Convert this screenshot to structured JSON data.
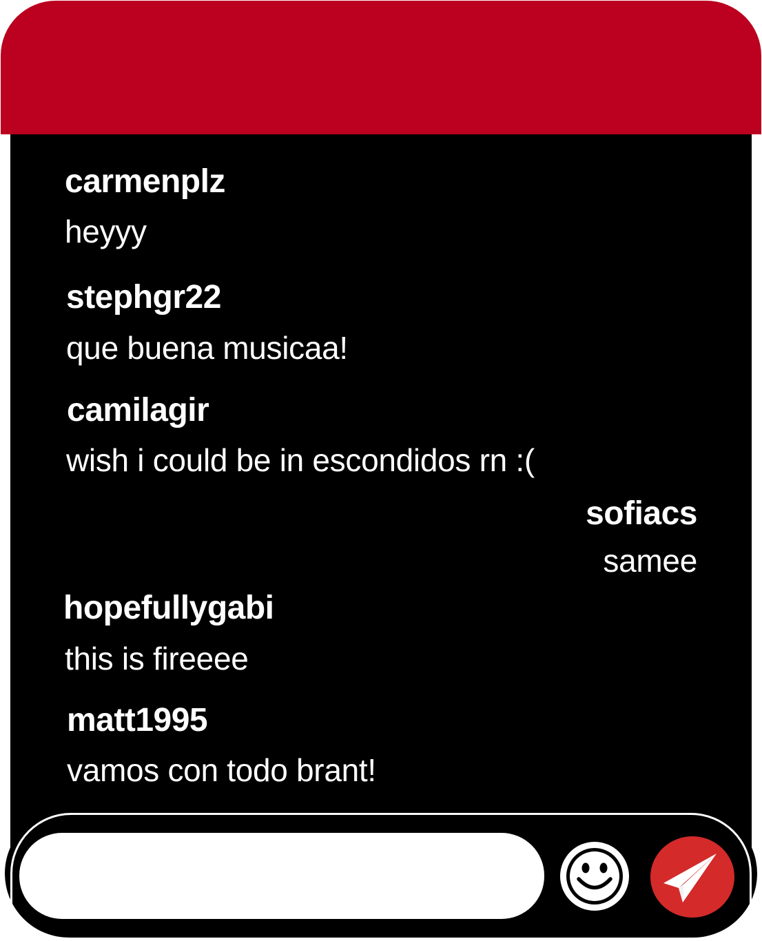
{
  "colors": {
    "header": "#bb0020",
    "background": "#000000",
    "text": "#ffffff",
    "send_button": "#d42a2a"
  },
  "messages": [
    {
      "username": "carmenplz",
      "text": "heyyy",
      "align": "left"
    },
    {
      "username": "stephgr22",
      "text": "que buena musicaa!",
      "align": "left"
    },
    {
      "username": "camilagir",
      "text": "wish i could be in escondidos rn :(",
      "align": "left"
    },
    {
      "username": "sofiacs",
      "text": "samee",
      "align": "right"
    },
    {
      "username": "hopefullygabi",
      "text": "this is fireeee",
      "align": "left"
    },
    {
      "username": "matt1995",
      "text": "vamos con todo brant!",
      "align": "left"
    }
  ],
  "composer": {
    "input_value": "",
    "emoji_icon": "smiley-icon",
    "send_icon": "paper-plane-icon"
  }
}
